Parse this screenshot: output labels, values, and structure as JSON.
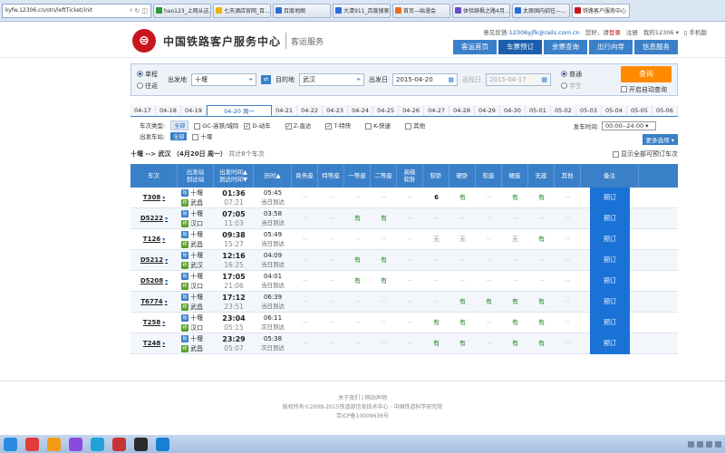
{
  "browser": {
    "url": "kyfw.12306.cn/otn/leftTicket/init",
    "tabs": [
      {
        "label": "hao123_上网从这...",
        "color": "#2e9c3a"
      },
      {
        "label": "七天酒店官网_百...",
        "color": "#e8b400"
      },
      {
        "label": "百度地图",
        "color": "#2a6ed8"
      },
      {
        "label": "大清911_百度搜索",
        "color": "#2a6ed8"
      },
      {
        "label": "首页—始漫会",
        "color": "#f06a1a"
      },
      {
        "label": "体验赫枫之路4月...",
        "color": "#6a4fc6"
      },
      {
        "label": "太原国内招往—...",
        "color": "#2a6ed8"
      },
      {
        "label": "铁路客户服务中心",
        "color": "#c9151e"
      }
    ]
  },
  "header": {
    "logo_text": "中国铁路客户服务中心",
    "sub_title": "客运服务",
    "feedback": "意见反馈:",
    "email": "12306yjfk@rails.com.cn",
    "login_prompt": "您好，请",
    "login": "登录",
    "register": "注册",
    "my": "我的12306",
    "mobile": "手机版"
  },
  "nav": [
    "客运首页",
    "车票预订",
    "余票查询",
    "出行向导",
    "信息服务"
  ],
  "search": {
    "oneway": "单程",
    "roundtrip": "往返",
    "from_label": "出发地",
    "from": "十堰",
    "to_label": "目的地",
    "to": "武汉",
    "date_label": "出发日",
    "date": "2015-04-20",
    "return_label": "返程日",
    "return_date": "2015-04-17",
    "normal": "普通",
    "student": "学生",
    "query": "查询",
    "auto_query": "开启自动查询"
  },
  "dates": [
    "04-17",
    "04-18",
    "04-19",
    "04-20 周一",
    "04-21",
    "04-22",
    "04-23",
    "04-24",
    "04-25",
    "04-26",
    "04-27",
    "04-28",
    "04-29",
    "04-30",
    "05-01",
    "05-02",
    "05-03",
    "05-04",
    "05-05",
    "05-06"
  ],
  "filters": {
    "type_label": "车次类型:",
    "all": "全部",
    "gc": "GC-高铁/城际",
    "d": "D-动车",
    "z": "Z-直达",
    "t": "T-特快",
    "k": "K-快速",
    "other": "其他",
    "depart_time_label": "发车时间:",
    "depart_time": "00:00--24:00",
    "station_label": "出发车站:",
    "station": "十堰",
    "more": "更多选项"
  },
  "summary": {
    "route": "十堰 --> 武汉 （4月20日 周一）",
    "count": "共计8个车次",
    "show_all": "显示全部可预订车次"
  },
  "columns": [
    "车次",
    "出发站\n到达站",
    "出发时间▲\n到达时间▼",
    "历时▲",
    "商务座",
    "特等座",
    "一等座",
    "二等座",
    "高级\n软卧",
    "软卧",
    "硬卧",
    "软座",
    "硬座",
    "无座",
    "其他",
    "备注"
  ],
  "book_label": "预订",
  "trains": [
    {
      "no": "T308",
      "from": "十堰",
      "to": "武昌",
      "dep": "01:36",
      "arr": "07:21",
      "dur": "05:45",
      "day": "当日到达",
      "seats": [
        "--",
        "--",
        "--",
        "--",
        "--",
        "6",
        "有",
        "--",
        "有",
        "有",
        "--"
      ]
    },
    {
      "no": "D5222",
      "from": "十堰",
      "to": "汉口",
      "dep": "07:05",
      "arr": "11:03",
      "dur": "03:58",
      "day": "当日到达",
      "seats": [
        "--",
        "--",
        "有",
        "有",
        "--",
        "--",
        "--",
        "--",
        "--",
        "--",
        "--"
      ]
    },
    {
      "no": "T126",
      "from": "十堰",
      "to": "武昌",
      "dep": "09:38",
      "arr": "15:27",
      "dur": "05:49",
      "day": "当日到达",
      "seats": [
        "--",
        "--",
        "--",
        "--",
        "--",
        "无",
        "无",
        "--",
        "无",
        "有",
        "--"
      ]
    },
    {
      "no": "D5212",
      "from": "十堰",
      "to": "武汉",
      "dep": "12:16",
      "arr": "16:25",
      "dur": "04:09",
      "day": "当日到达",
      "seats": [
        "--",
        "--",
        "有",
        "有",
        "--",
        "--",
        "--",
        "--",
        "--",
        "--",
        "--"
      ]
    },
    {
      "no": "D5208",
      "from": "十堰",
      "to": "汉口",
      "dep": "17:05",
      "arr": "21:06",
      "dur": "04:01",
      "day": "当日到达",
      "seats": [
        "--",
        "--",
        "有",
        "有",
        "--",
        "--",
        "--",
        "--",
        "--",
        "--",
        "--"
      ]
    },
    {
      "no": "T6774",
      "from": "十堰",
      "to": "武昌",
      "dep": "17:12",
      "arr": "23:51",
      "dur": "06:39",
      "day": "当日到达",
      "seats": [
        "--",
        "--",
        "--",
        "--",
        "--",
        "--",
        "有",
        "有",
        "有",
        "有",
        "--"
      ]
    },
    {
      "no": "T258",
      "from": "十堰",
      "to": "汉口",
      "dep": "23:04",
      "arr": "05:15",
      "dur": "06:11",
      "day": "次日到达",
      "seats": [
        "--",
        "--",
        "--",
        "--",
        "--",
        "有",
        "有",
        "--",
        "有",
        "有",
        "--"
      ]
    },
    {
      "no": "T248",
      "from": "十堰",
      "to": "武昌",
      "dep": "23:29",
      "arr": "05:07",
      "dur": "05:38",
      "day": "次日到达",
      "seats": [
        "--",
        "--",
        "--",
        "--",
        "--",
        "有",
        "有",
        "--",
        "有",
        "有",
        "--"
      ]
    }
  ],
  "footer": {
    "links": "关于我们 | 网站声明",
    "copyright": "版权所有©2008-2015铁道部信息技术中心 · 中国铁道科学研究院",
    "icp": "京ICP备10009636号"
  },
  "taskbar": {
    "colors": [
      "#2a8ae0",
      "#e23b3b",
      "#f29b16",
      "#8a4ae0",
      "#1fa3d8",
      "#c63535",
      "#2b2b2b",
      "#1a7fd4"
    ]
  }
}
